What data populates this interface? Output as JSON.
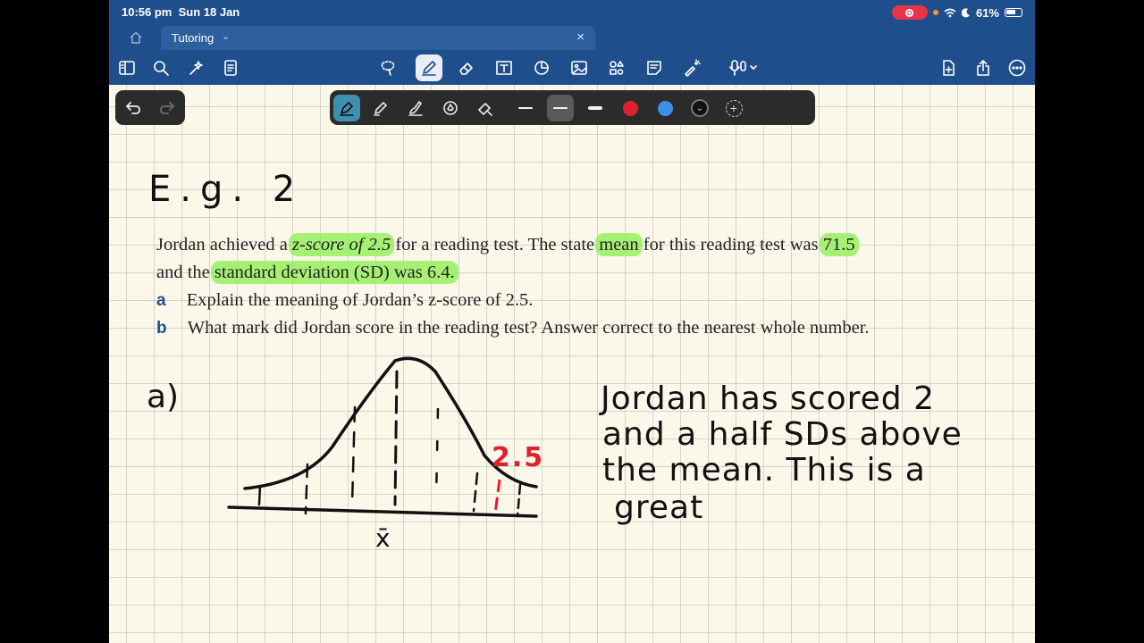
{
  "status_bar": {
    "time": "10:56 pm",
    "date": "Sun 18 Jan",
    "battery": "61%"
  },
  "tab": {
    "title": "Tutoring"
  },
  "toolbar": {
    "left_icons": [
      "sidebar-icon",
      "search-icon",
      "sparkle-icon",
      "document-icon"
    ],
    "tools": [
      "lasso-icon",
      "pen-icon",
      "eraser-icon",
      "text-box-icon",
      "shapes-icon",
      "image-icon",
      "elements-icon",
      "sticky-note-icon",
      "laser-pointer-icon",
      "microphone-icon"
    ],
    "right_icons": [
      "add-page-icon",
      "share-icon",
      "more-icon"
    ],
    "active_tool": "pen-icon"
  },
  "pen_options": {
    "pen_types": [
      "fountain-pen-icon",
      "ballpoint-pen-icon",
      "brush-pen-icon",
      "shape-pen-icon",
      "eraser-pen-icon"
    ],
    "colors": [
      "#e0202c",
      "#3f8fe6"
    ],
    "selected_weight": "medium"
  },
  "question": {
    "line1_pre": "Jordan achieved a",
    "line1_hl1": "z-score of 2.5",
    "line1_mid": "for a reading test. The state",
    "line1_hl2": "mean",
    "line1_mid2": "for this reading test was",
    "line1_hl3": "71.5",
    "line2_pre": "and the",
    "line2_hl": "standard deviation (SD) was 6.4.",
    "part_a_label": "a",
    "part_a_text": "Explain the meaning of Jordan’s z-score of 2.5.",
    "part_b_label": "b",
    "part_b_text": "What mark did Jordan score in the reading test? Answer correct to the nearest whole number."
  },
  "handwriting": {
    "heading": "E.g. 2",
    "part_label": "a)",
    "zscore_label": "2.5",
    "mean_symbol": "x̄",
    "answer_line1": "Jordan has scored 2",
    "answer_line2": "and a half SDs above",
    "answer_line3": "the mean. This is a",
    "answer_line4": "great"
  },
  "colors": {
    "topbar": "#1f4e8c",
    "highlight": "#96f05f",
    "red_ink": "#e0202c",
    "paper": "#fbf8ea"
  }
}
